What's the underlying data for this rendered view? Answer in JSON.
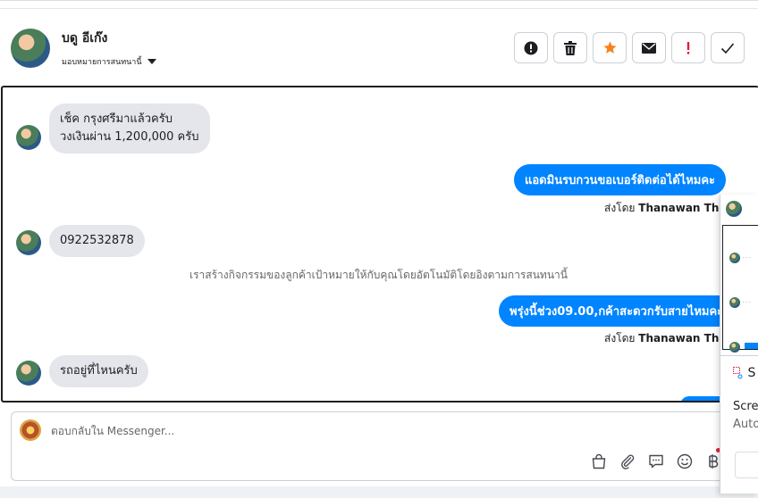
{
  "header": {
    "contact_name": "บดู อีเก๊ง",
    "assignee_label": "มอบหมายการสนทนานี้"
  },
  "actions": [
    {
      "name": "mark-spam-button",
      "glyph": "!",
      "icon": "alert-circle-icon"
    },
    {
      "name": "delete-button",
      "glyph": "",
      "icon": "trash-icon"
    },
    {
      "name": "star-button",
      "glyph": "★",
      "icon": "star-icon"
    },
    {
      "name": "mark-unread-button",
      "glyph": "✉",
      "icon": "envelope-icon"
    },
    {
      "name": "follow-up-button",
      "glyph": "!",
      "icon": "exclamation-icon"
    },
    {
      "name": "mark-done-button",
      "glyph": "✓",
      "icon": "check-icon"
    }
  ],
  "colors": {
    "accent": "#0084ff",
    "star": "#f5821f",
    "follow_up": "#e41e3f"
  },
  "conversation": {
    "messages": [
      {
        "dir": "in",
        "lines": [
          "เช็ค กรุงศรีมาแล้วครับ",
          "วงเงินผ่าน 1,200,000 ครับ"
        ]
      },
      {
        "dir": "out",
        "text": "แอดมินรบกวนขอเบอร์ติดต่อได้ไหมคะ",
        "sent_by_prefix": "ส่งโดย",
        "sent_by_name": "Thanawan Thon"
      },
      {
        "dir": "in",
        "text": "0922532878"
      },
      {
        "dir": "system",
        "text": "เราสร้างกิจกรรมของลูกค้าเป้าหมายให้กับคุณโดยอัตโนมัติโดยอิงตามการสนทนานี้"
      },
      {
        "dir": "out",
        "text": "พรุ่งนี้ช่วง09.00,กค้าสะดวกรับสายไหมคะ",
        "sent_by_prefix": "ส่งโดย",
        "sent_by_name": "Thanawan Thon"
      },
      {
        "dir": "in",
        "text": "รถอยู่ที่ไหนครับ"
      }
    ]
  },
  "reply": {
    "placeholder": "ตอบกลับใน Messenger..."
  },
  "overlay": {
    "snip_title": "S",
    "line1": "Scree",
    "line2": "Auto"
  }
}
